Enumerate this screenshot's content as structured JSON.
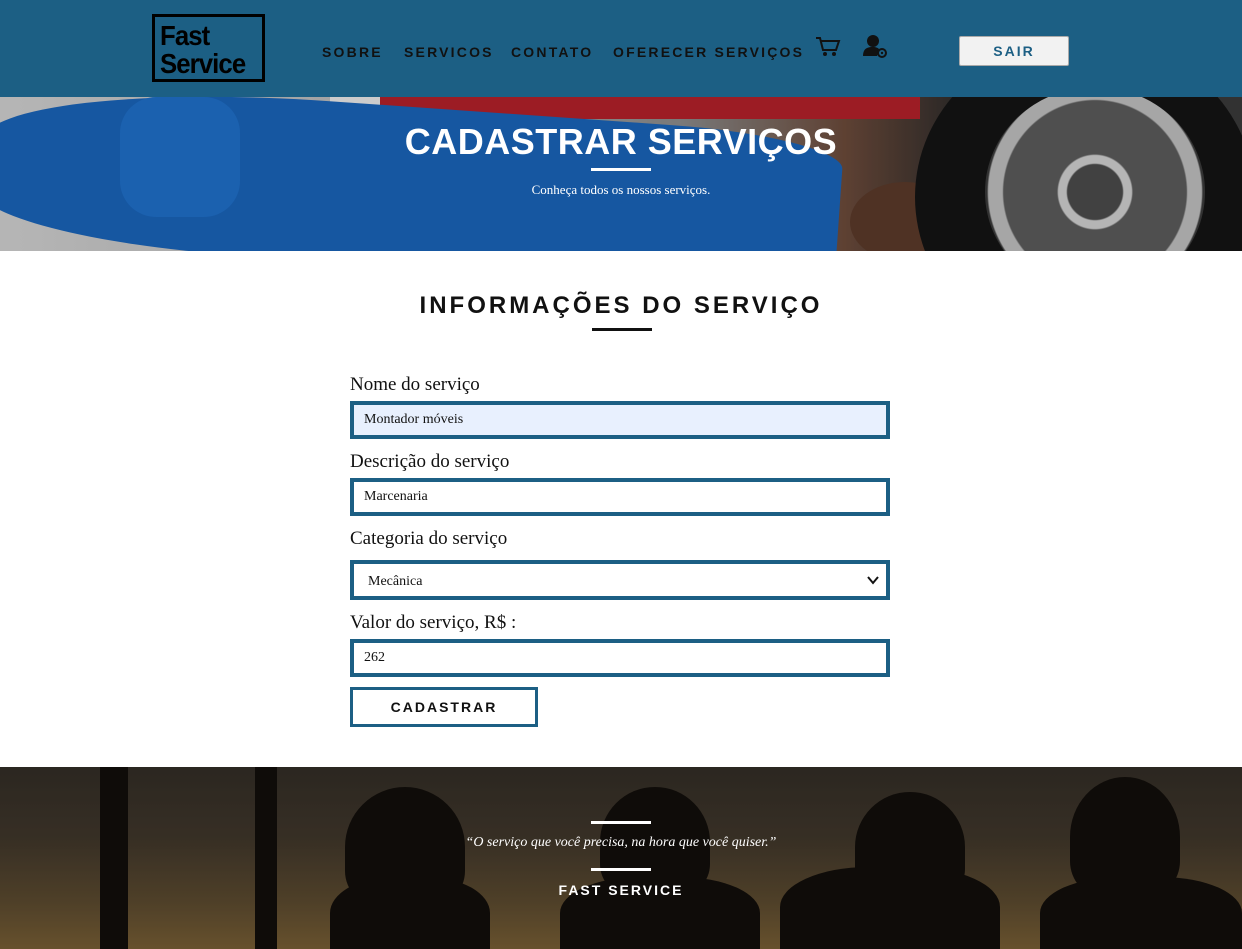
{
  "header": {
    "logo_line1": "Fast",
    "logo_line2": "Service",
    "nav": [
      "SOBRE",
      "SERVICOS",
      "CONTATO",
      "OFERECER SERVIÇOS"
    ],
    "logout_label": "SAIR",
    "icons": [
      "cart-icon",
      "user-settings-icon"
    ]
  },
  "hero": {
    "title": "CADASTRAR SERVIÇOS",
    "subtitle": "Conheça todos os nossos serviços."
  },
  "form": {
    "title": "INFORMAÇÕES DO SERVIÇO",
    "name_label": "Nome do serviço",
    "name_value": "Montador móveis",
    "description_label": "Descrição do serviço",
    "description_value": "Marcenaria",
    "category_label": "Categoria do serviço",
    "category_value": "Mecânica",
    "price_label": "Valor do serviço, R$ :",
    "price_value": "262",
    "submit_label": "CADASTRAR"
  },
  "footer": {
    "quote": "“O serviço que você precisa, na hora que você quiser.”",
    "brand": "FAST SERVICE"
  },
  "colors": {
    "primary": "#1c5f84",
    "autofill": "#e8f0fe"
  }
}
